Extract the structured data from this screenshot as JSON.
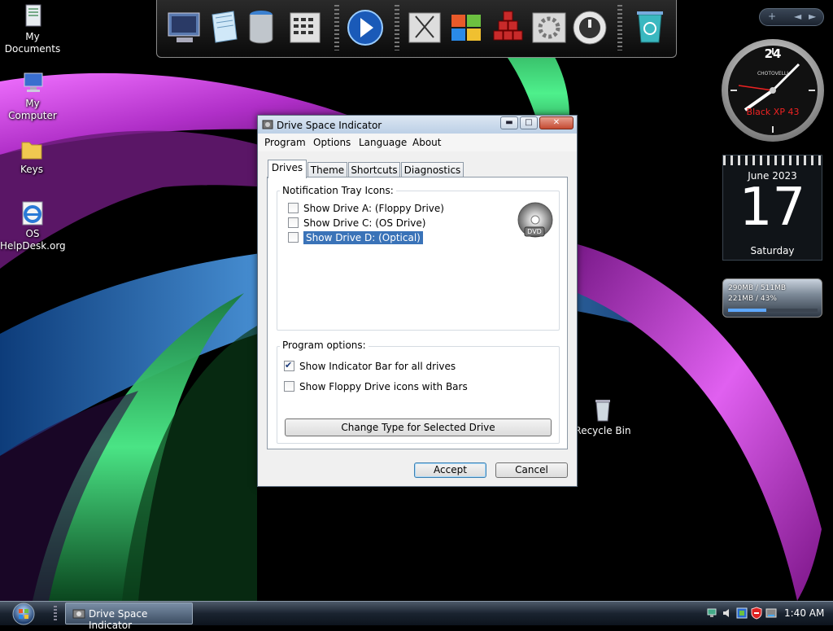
{
  "desktop": {
    "icons": [
      {
        "label_line1": "My",
        "label_line2": "Documents"
      },
      {
        "label_line1": "My Computer",
        "label_line2": ""
      },
      {
        "label_line1": "Keys",
        "label_line2": ""
      },
      {
        "label_line1": "OS",
        "label_line2": "HelpDesk.org"
      },
      {
        "label_line1": "Recycle Bin",
        "label_line2": ""
      }
    ]
  },
  "dock": {
    "items": [
      "display-settings-icon",
      "notepad-icon",
      "paint-bucket-icon",
      "calculator-icon",
      "media-player-icon",
      "cut-tool-icon",
      "windows-logo-icon",
      "blocks-icon",
      "control-panel-icon",
      "shutdown-icon",
      "recycle-bin-icon"
    ]
  },
  "gadgets": {
    "buttons": [
      "+",
      "◄",
      "►"
    ],
    "clock": {
      "top_number": "24",
      "brand": "CHOTOVELLI",
      "caption": "Black XP 43"
    },
    "calendar": {
      "month": "June 2023",
      "day": "17",
      "weekday": "Saturday"
    },
    "meter": {
      "line1": "290MB / 511MB",
      "line2": "221MB / 43%",
      "fill_fraction": 0.43
    }
  },
  "dialog": {
    "title": "Drive Space Indicator",
    "title_buttons": {
      "minimize": "▬",
      "maximize": "□",
      "close": "✕"
    },
    "menu": [
      "Program",
      "Options",
      "Language",
      "About"
    ],
    "tabs": [
      "Drives",
      "Theme",
      "Shortcuts",
      "Diagnostics"
    ],
    "active_tab": "Drives",
    "tray_group": {
      "label": "Notification Tray Icons:",
      "items": [
        {
          "label": "Show Drive A: (Floppy Drive)",
          "checked": false
        },
        {
          "label": "Show Drive C: (OS Drive)",
          "checked": false
        },
        {
          "label": "Show Drive D: (Optical)",
          "checked": false
        }
      ],
      "dvd_label": "DVD"
    },
    "options_group": {
      "label": "Program options:",
      "items": [
        {
          "label": "Show Indicator Bar for all drives",
          "checked": true
        },
        {
          "label": "Show Floppy Drive icons with Bars",
          "checked": false
        }
      ],
      "change_button": "Change Type for Selected Drive"
    },
    "accept": "Accept",
    "cancel": "Cancel"
  },
  "taskbar": {
    "task_label": "Drive Space Indicator",
    "time": "1:40 AM"
  },
  "colors": {
    "selection": "#3a73b8",
    "magenta": "#d24fe0",
    "green": "#2fd17a",
    "blue": "#3a86d6"
  }
}
